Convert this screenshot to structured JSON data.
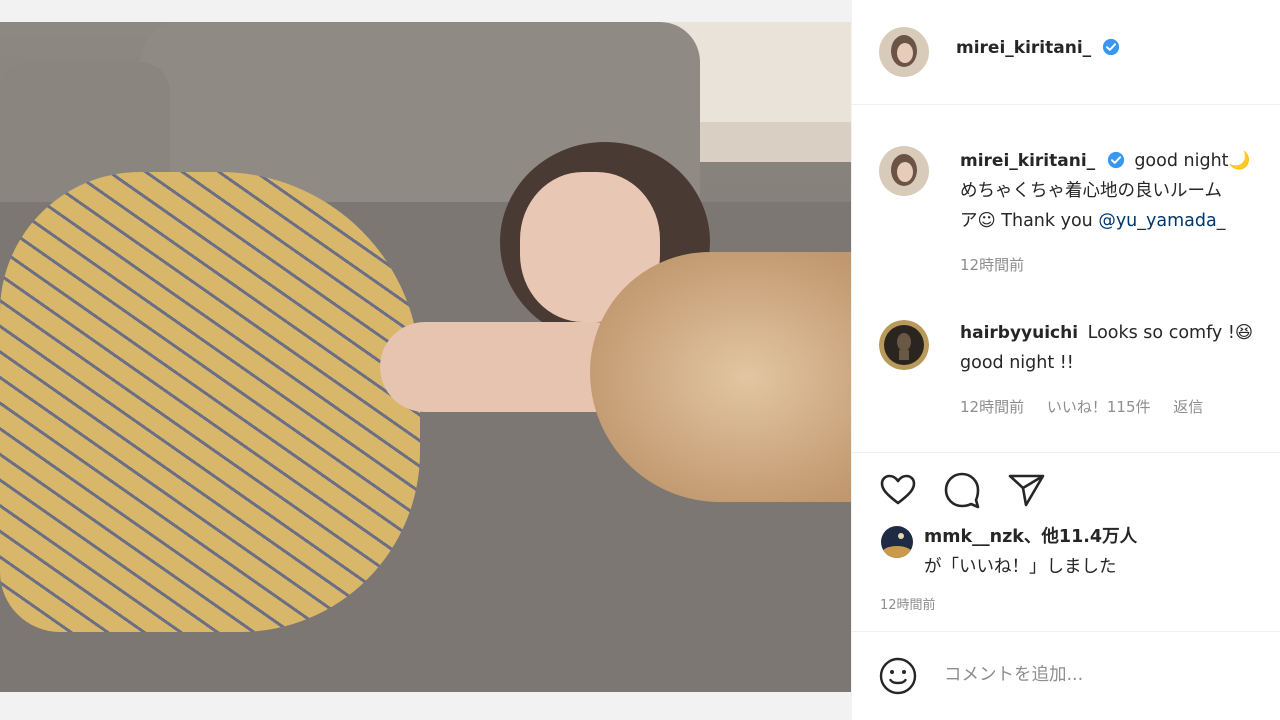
{
  "post": {
    "username": "mirei_kiritani_",
    "verified": true,
    "caption_line1": "good night",
    "caption_moon": "🌙",
    "caption_line2": "めちゃくちゃ着心地の良いルーム",
    "caption_line3_prefix": "ア☺ Thank you ",
    "caption_mention": "@yu_yamada_",
    "caption_time": "12時間前"
  },
  "comments": [
    {
      "username": "hairbyyuichi",
      "text_line1": "Looks so comfy !😆",
      "text_line2": "good night !!",
      "time": "12時間前",
      "likes": "いいね！115件",
      "reply": "返信"
    }
  ],
  "actions": {
    "like_icon": "heart-icon",
    "comment_icon": "comment-icon",
    "share_icon": "send-icon"
  },
  "likes_summary": {
    "user": "mmk__nzk",
    "suffix_bold": "、他11.4万人",
    "line2": "が「いいね！」しました"
  },
  "post_time": "12時間前",
  "comment_box": {
    "emoji_icon": "smiley-icon",
    "placeholder": "コメントを追加..."
  },
  "colors": {
    "verified": "#3897f0",
    "mention": "#00376b",
    "muted": "#8e8e8e"
  }
}
